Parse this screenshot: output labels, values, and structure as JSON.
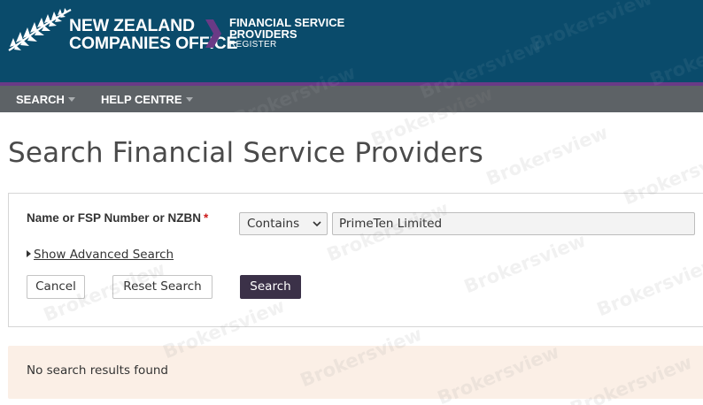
{
  "header": {
    "brand_line1": "NEW ZEALAND",
    "brand_line2": "COMPANIES OFFICE",
    "register_line1": "FINANCIAL SERVICE",
    "register_line2": "PROVIDERS",
    "register_line3": "REGISTER",
    "background_color": "#0a4b6b",
    "accent_color": "#6a3a86"
  },
  "nav": {
    "items": [
      {
        "label": "SEARCH",
        "icon": "chevron-down-icon"
      },
      {
        "label": "HELP CENTRE",
        "icon": "chevron-down-icon"
      }
    ]
  },
  "page": {
    "title": "Search Financial Service Providers"
  },
  "search_form": {
    "field_label": "Name or FSP Number or NZBN",
    "required_marker": "*",
    "match_select_value": "Contains",
    "query_value": "PrimeTen Limited",
    "advanced_link": "Show Advanced Search",
    "cancel_label": "Cancel",
    "reset_label": "Reset Search",
    "search_label": "Search",
    "search_button_color": "#3b3148"
  },
  "results": {
    "message": "No search results found",
    "background_color": "#fbefe6"
  },
  "watermark": {
    "text": "Brokersview"
  }
}
